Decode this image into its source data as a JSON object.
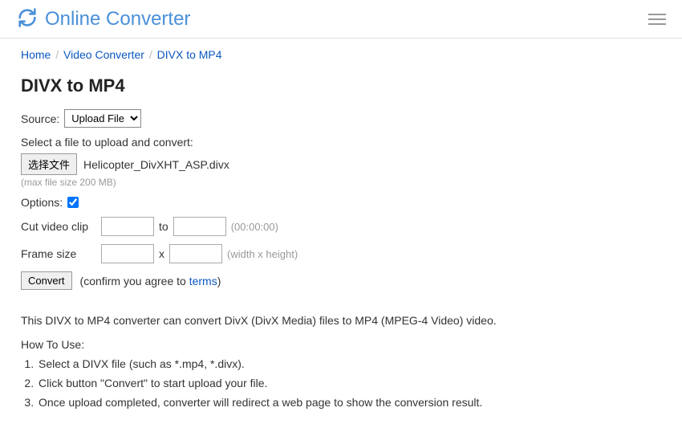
{
  "header": {
    "site_title": "Online Converter"
  },
  "breadcrumb": {
    "home": "Home",
    "cat": "Video Converter",
    "current": "DIVX to MP4"
  },
  "page": {
    "title": "DIVX to MP4",
    "source_label": "Source:",
    "source_value": "Upload File",
    "select_file_label": "Select a file to upload and convert:",
    "choose_file_btn": "选择文件",
    "selected_file": "Helicopter_DivXHT_ASP.divx",
    "max_size_hint": "(max file size 200 MB)",
    "options_label": "Options:",
    "cut_label": "Cut video clip",
    "cut_sep": "to",
    "cut_hint": "(00:00:00)",
    "frame_label": "Frame size",
    "frame_sep": "x",
    "frame_hint": "(width x height)",
    "convert_btn": "Convert",
    "confirm_prefix": "(confirm you agree to ",
    "terms_link": "terms",
    "confirm_suffix": ")",
    "description": "This DIVX to MP4 converter can convert DivX (DivX Media) files to MP4 (MPEG-4 Video) video.",
    "howto_title": "How To Use:",
    "howto_steps": [
      "Select a DIVX file (such as *.mp4, *.divx).",
      "Click button \"Convert\" to start upload your file.",
      "Once upload completed, converter will redirect a web page to show the conversion result."
    ]
  }
}
